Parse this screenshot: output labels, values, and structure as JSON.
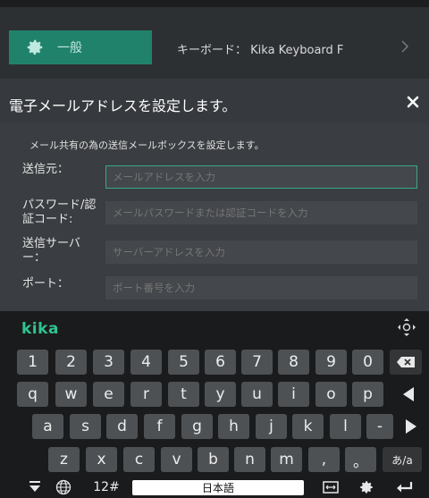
{
  "settings_bar": {
    "tab_general": "一般",
    "keyboard_setting": "キーボード： Kika Keyboard F"
  },
  "dialog": {
    "title": "電子メールアドレスを設定します。",
    "description": "メール共有の為の送信メールボックスを設定します。",
    "fields": [
      {
        "label": "送信元：",
        "placeholder": "メールアドレスを入力"
      },
      {
        "label": "パスワード/認\n証コード:",
        "placeholder": "メールパスワードまたは認証コードを入力"
      },
      {
        "label": "送信サーバ\nー：",
        "placeholder": "サーバーアドレスを入力"
      },
      {
        "label": "ポート：",
        "placeholder": "ポート番号を入力"
      }
    ]
  },
  "keyboard": {
    "logo": "kika",
    "row_numbers": [
      "1",
      "2",
      "3",
      "4",
      "5",
      "6",
      "7",
      "8",
      "9",
      "0"
    ],
    "row_top": [
      "q",
      "w",
      "e",
      "r",
      "t",
      "y",
      "u",
      "i",
      "o",
      "p"
    ],
    "row_mid": [
      "a",
      "s",
      "d",
      "f",
      "g",
      "h",
      "j",
      "k",
      "l",
      "-"
    ],
    "row_bottom": [
      "z",
      "x",
      "c",
      "v",
      "b",
      "n",
      "m",
      ",",
      "。"
    ],
    "kana_toggle": "あ/a",
    "symbols": "12#",
    "space_label": "日本語"
  },
  "colors": {
    "accent": "#21826c",
    "logo": "#2fc38f",
    "focus_border": "#39a889"
  }
}
